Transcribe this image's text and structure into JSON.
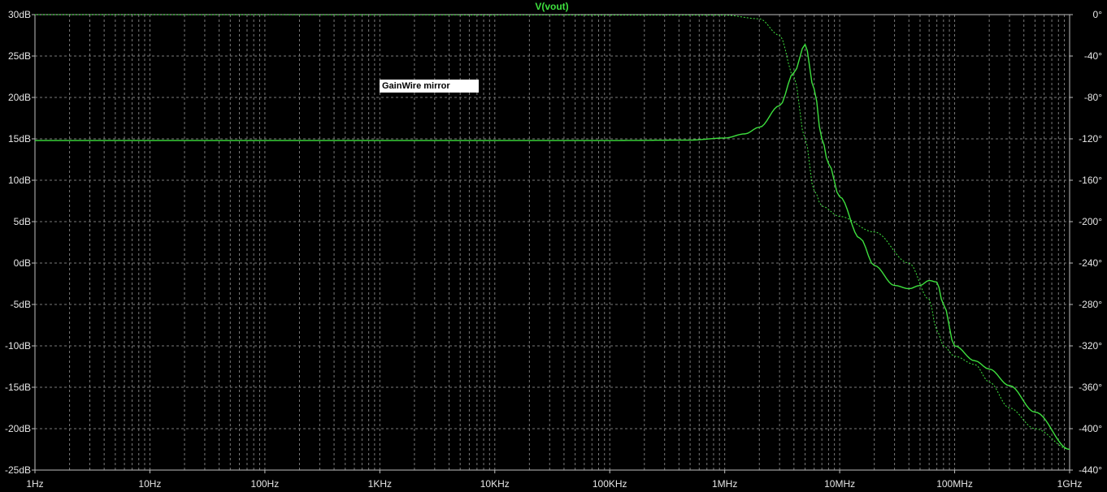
{
  "chart_data": {
    "type": "line",
    "title": "V(vout)",
    "xscale": "log",
    "x_ticks": [
      "1Hz",
      "10Hz",
      "100Hz",
      "1KHz",
      "10KHz",
      "100KHz",
      "1MHz",
      "10MHz",
      "100MHz",
      "1GHz"
    ],
    "xlim": [
      1,
      1000000000
    ],
    "y_left_ticks": [
      "30dB",
      "25dB",
      "20dB",
      "15dB",
      "10dB",
      "5dB",
      "0dB",
      "-5dB",
      "-10dB",
      "-15dB",
      "-20dB",
      "-25dB"
    ],
    "ylim_left": [
      -25,
      30
    ],
    "y_right_ticks": [
      "0°",
      "-40°",
      "-80°",
      "-120°",
      "-160°",
      "-200°",
      "-240°",
      "-280°",
      "-320°",
      "-360°",
      "-400°",
      "-440°"
    ],
    "ylim_right": [
      -440,
      0
    ],
    "grid": true,
    "annotation": "GainWire mirror",
    "colors": {
      "background": "#000000",
      "trace": "#3ee03e",
      "grid": "#7a7a7a",
      "title": "#3ee03e"
    },
    "series": [
      {
        "name": "V(vout)",
        "kind": "magnitude_dB",
        "style": "solid",
        "points": [
          [
            1,
            14.8
          ],
          [
            1000,
            14.8
          ],
          [
            100000,
            14.8
          ],
          [
            500000,
            14.85
          ],
          [
            1000000,
            15.1
          ],
          [
            1500000,
            15.6
          ],
          [
            2000000,
            16.4
          ],
          [
            3000000,
            19
          ],
          [
            4000000,
            23
          ],
          [
            5000000,
            26.4
          ],
          [
            6000000,
            21
          ],
          [
            7000000,
            15
          ],
          [
            8000000,
            12
          ],
          [
            10000000,
            8
          ],
          [
            15000000,
            3
          ],
          [
            20000000,
            -0.3
          ],
          [
            30000000,
            -2.7
          ],
          [
            40000000,
            -3.1
          ],
          [
            50000000,
            -2.7
          ],
          [
            60000000,
            -2.1
          ],
          [
            70000000,
            -2.3
          ],
          [
            80000000,
            -5
          ],
          [
            100000000,
            -10
          ],
          [
            150000000,
            -11.8
          ],
          [
            200000000,
            -12.8
          ],
          [
            300000000,
            -14.8
          ],
          [
            500000000,
            -18
          ],
          [
            1000000000,
            -22.5
          ]
        ]
      },
      {
        "name": "V(vout) phase",
        "kind": "phase_deg",
        "style": "dotted",
        "points": [
          [
            1,
            0
          ],
          [
            1000000,
            -0.5
          ],
          [
            2000000,
            -4
          ],
          [
            3000000,
            -20
          ],
          [
            4000000,
            -60
          ],
          [
            5000000,
            -120
          ],
          [
            6000000,
            -170
          ],
          [
            7000000,
            -185
          ],
          [
            10000000,
            -195
          ],
          [
            20000000,
            -210
          ],
          [
            40000000,
            -240
          ],
          [
            60000000,
            -275
          ],
          [
            70000000,
            -305
          ],
          [
            80000000,
            -320
          ],
          [
            100000000,
            -330
          ],
          [
            150000000,
            -338
          ],
          [
            200000000,
            -355
          ],
          [
            300000000,
            -380
          ],
          [
            500000000,
            -400
          ],
          [
            1000000000,
            -420
          ]
        ]
      }
    ]
  }
}
